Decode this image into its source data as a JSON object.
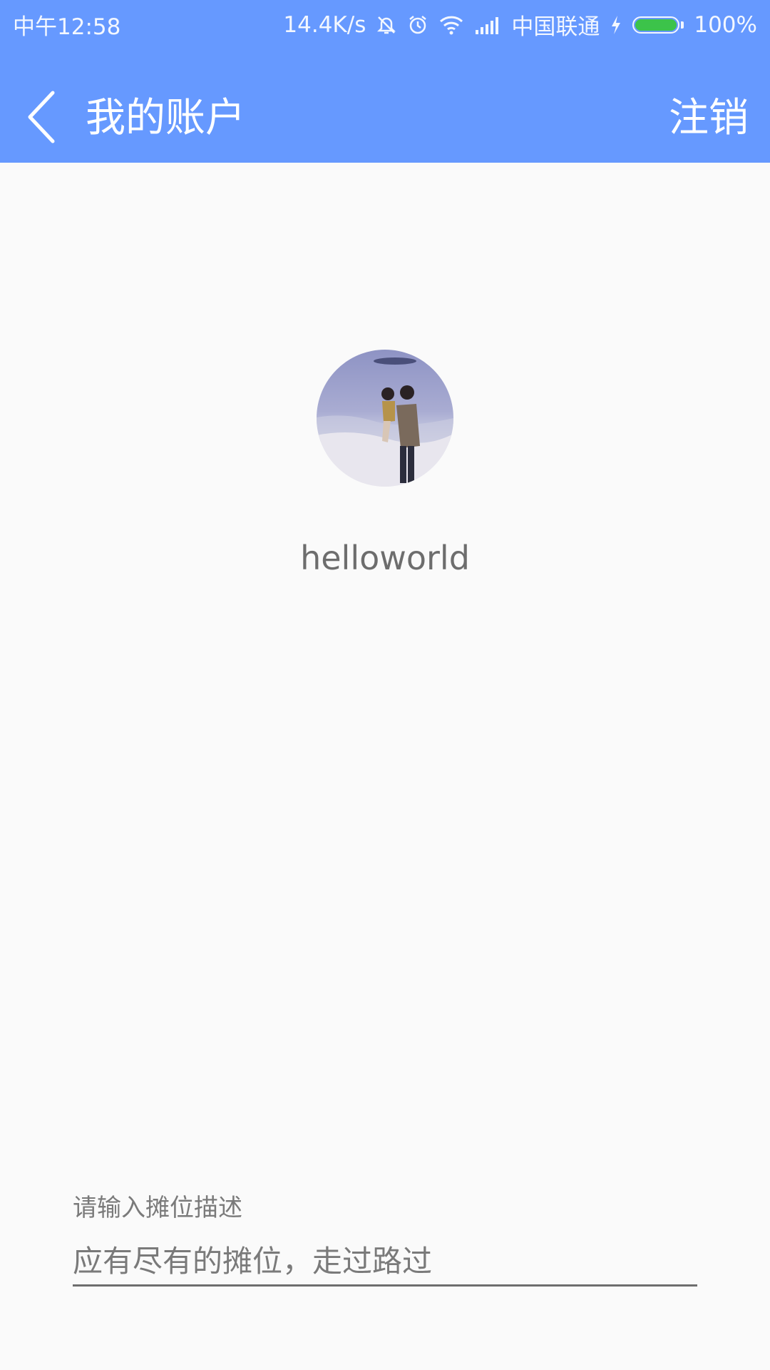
{
  "status_bar": {
    "time": "中午12:58",
    "speed": "14.4K/s",
    "carrier": "中国联通",
    "battery": "100%",
    "icons": [
      "mute-icon",
      "alarm-icon",
      "wifi-icon",
      "signal-icon",
      "charging-icon",
      "battery-icon"
    ],
    "battery_fill_color": "#3cc34a"
  },
  "app_bar": {
    "title": "我的账户",
    "logout_label": "注销",
    "back_icon": "chevron-left-icon",
    "background": "#6699ff"
  },
  "profile": {
    "username": "helloworld"
  },
  "stall_field": {
    "label": "请输入摊位描述",
    "value": "应有尽有的摊位，走过路过"
  }
}
